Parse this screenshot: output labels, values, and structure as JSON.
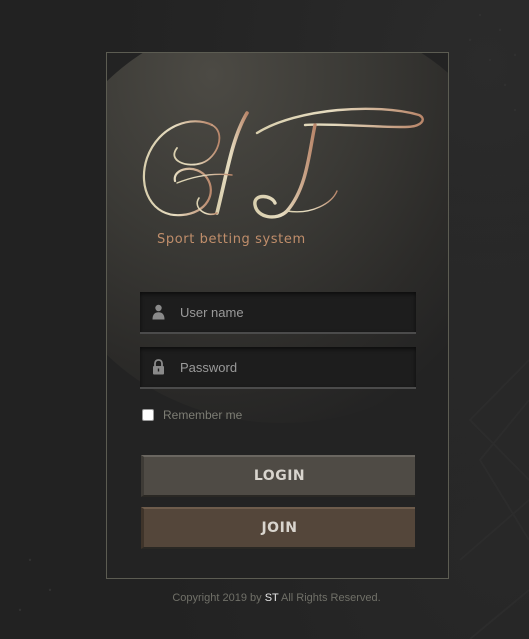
{
  "logo": {
    "letters": "ST",
    "tagline": "Sport betting system"
  },
  "login_form": {
    "username_placeholder": "User name",
    "password_placeholder": "Password",
    "username_icon": "user-icon",
    "password_icon": "lock-icon",
    "remember_label": "Remember me",
    "remember_checked": false,
    "login_label": "LOGIN",
    "join_label": "JOIN"
  },
  "footer": {
    "prefix": "Copyright 2019 by ",
    "brand": "ST",
    "suffix": " All Rights Reserved."
  },
  "colors": {
    "accent_gold": "#c08e6b",
    "login_button": "#4f4b45",
    "join_button": "#54463a"
  }
}
